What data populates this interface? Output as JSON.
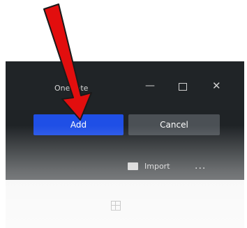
{
  "window": {
    "title": "OneNote",
    "controls": {
      "minimize": "—",
      "close": "✕"
    }
  },
  "buttons": {
    "add": "Add",
    "cancel": "Cancel"
  },
  "toolbar": {
    "import": "Import",
    "more": "..."
  },
  "icons": {
    "arrow": "red-arrow-icon",
    "grid": "grid-icon",
    "import": "import-icon"
  },
  "colors": {
    "accent": "#1f4fe6",
    "arrow": "#e20e0e",
    "window_bg": "#1f2326",
    "cancel_bg": "#4b5055"
  }
}
